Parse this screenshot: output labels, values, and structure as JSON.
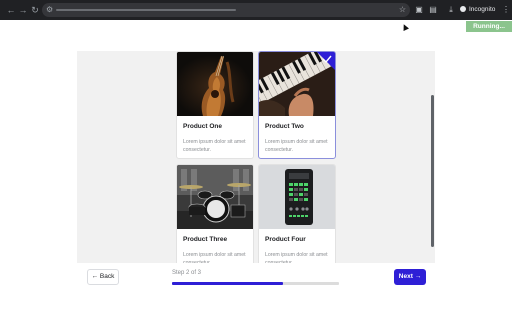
{
  "browser": {
    "incognito_label": "Incognito"
  },
  "status": {
    "running_label": "Running..."
  },
  "products": [
    {
      "title": "Product One",
      "description": "Lorem ipsum dolor sit amet consectetur.",
      "selected": false
    },
    {
      "title": "Product Two",
      "description": "Lorem ipsum dolor sit amet consectetur.",
      "selected": true
    },
    {
      "title": "Product Three",
      "description": "Lorem ipsum dolor sit amet consectetur.",
      "selected": false
    },
    {
      "title": "Product Four",
      "description": "Lorem ipsum dolor sit amet consectetur.",
      "selected": false
    }
  ],
  "footer": {
    "back_label": "← Back",
    "step_label": "Step 2 of 3",
    "progress": 0.667,
    "next_label": "Next →"
  },
  "colors": {
    "accent": "#2e1fd6",
    "selected_border": "#8b8fdc",
    "running_bg": "#8bc48d"
  }
}
